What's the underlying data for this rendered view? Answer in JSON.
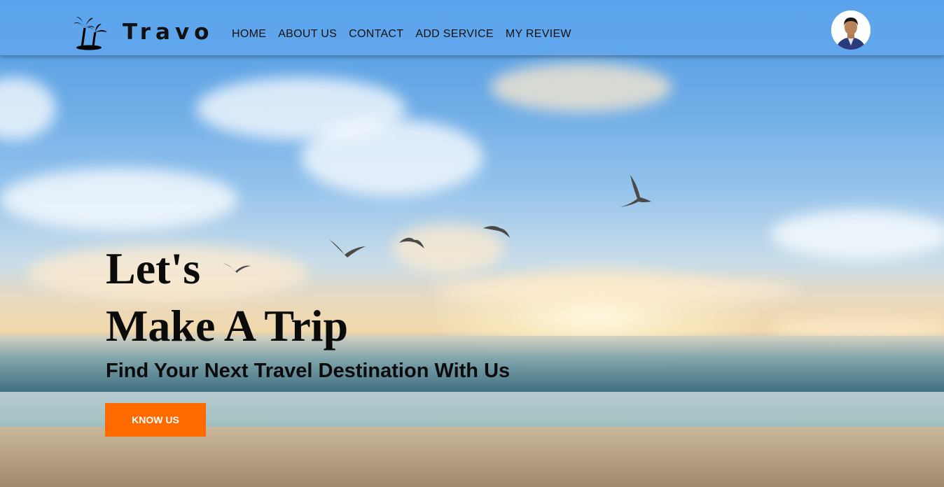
{
  "brand": {
    "name": "Travo",
    "logo_icon": "palm-trees-icon"
  },
  "nav": {
    "items": [
      {
        "label": "HOME"
      },
      {
        "label": "ABOUT US"
      },
      {
        "label": "CONTACT"
      },
      {
        "label": "ADD SERVICE"
      },
      {
        "label": "MY REVIEW"
      }
    ]
  },
  "user": {
    "avatar_icon": "user-avatar-icon"
  },
  "hero": {
    "title_line1": "Let's",
    "title_line2": "Make A Trip",
    "subtitle": "Find Your Next Travel Destination With Us",
    "cta_label": "KNOW US"
  },
  "colors": {
    "accent": "#ff6a00",
    "header_bg": "#64aaf0",
    "text": "#0b0b0b"
  }
}
